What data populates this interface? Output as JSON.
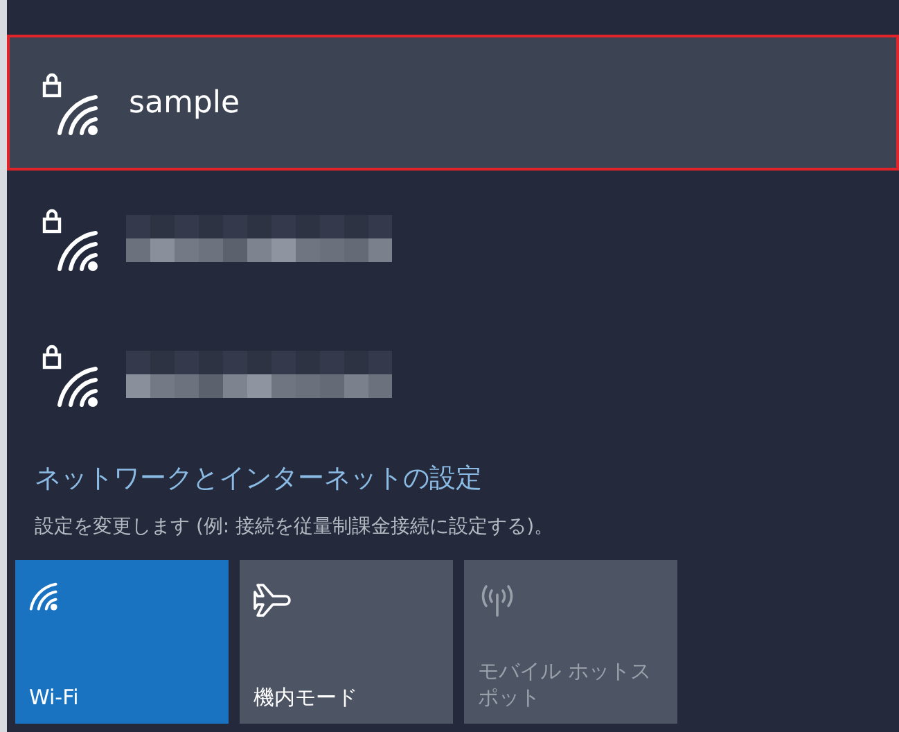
{
  "networks": [
    {
      "kind": "named",
      "name": "sample",
      "selected": true
    },
    {
      "kind": "redacted",
      "selected": false
    },
    {
      "kind": "redacted",
      "selected": false
    }
  ],
  "settings_link": "ネットワークとインターネットの設定",
  "settings_description": "設定を変更します (例: 接続を従量制課金接続に設定する)。",
  "tiles": [
    {
      "kind": "wifi",
      "label": "Wi-Fi",
      "on": true,
      "disabled": false
    },
    {
      "kind": "airplane",
      "label": "機内モード",
      "on": false,
      "disabled": false
    },
    {
      "kind": "hotspot",
      "label": "モバイル ホットスポット",
      "on": false,
      "disabled": true
    }
  ]
}
